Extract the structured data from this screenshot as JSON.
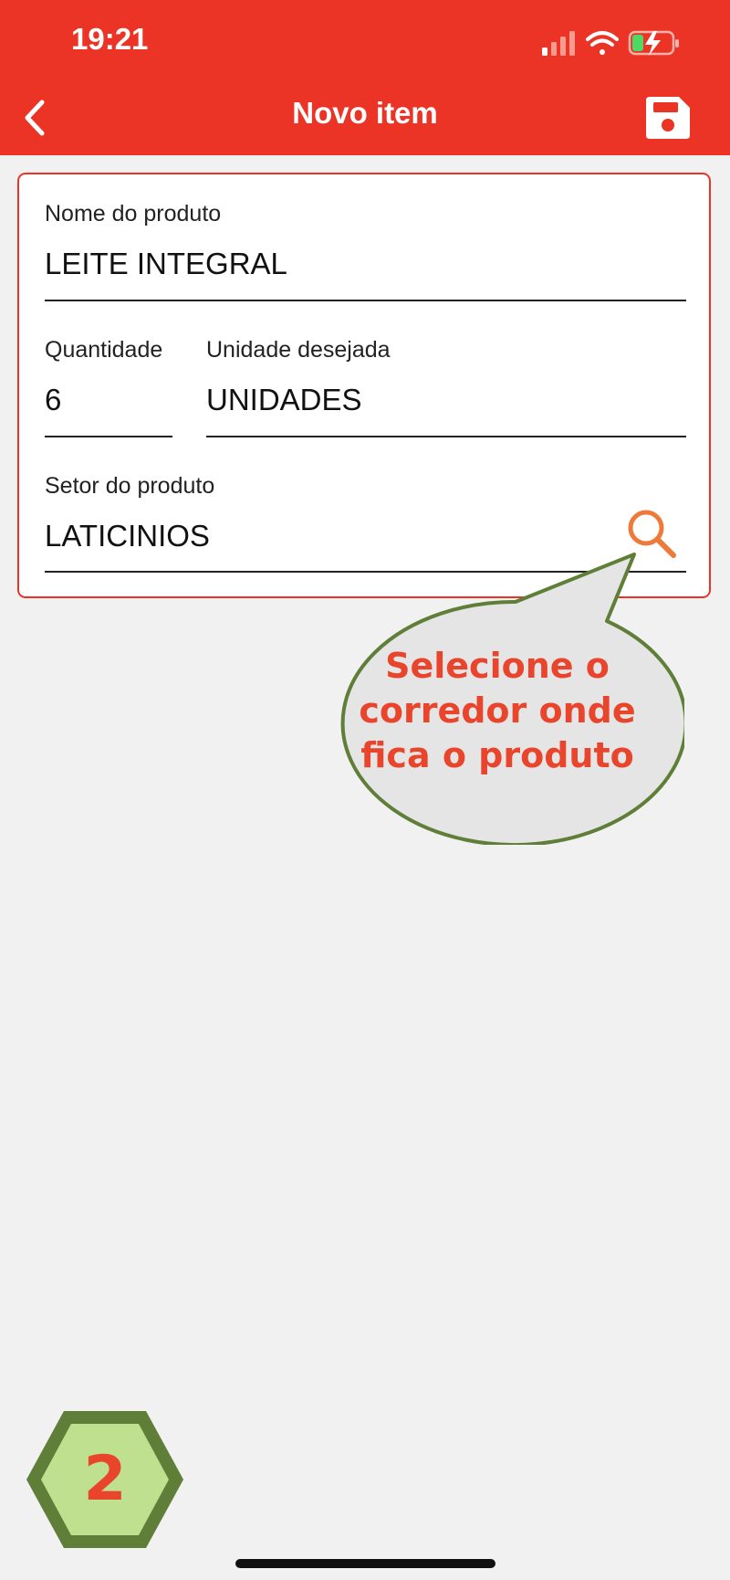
{
  "status_bar": {
    "time": "19:21"
  },
  "header": {
    "title": "Novo item"
  },
  "form": {
    "product_name": {
      "label": "Nome do produto",
      "value": "LEITE INTEGRAL"
    },
    "quantity": {
      "label": "Quantidade",
      "value": "6"
    },
    "unit": {
      "label": "Unidade desejada",
      "value": "UNIDADES"
    },
    "sector": {
      "label": "Setor do produto",
      "value": "LATICINIOS"
    }
  },
  "tooltip": {
    "line1": "Selecione o",
    "line2": "corredor onde",
    "line3": "fica o produto"
  },
  "step_badge": {
    "number": "2"
  },
  "colors": {
    "header_red": "#eb3425",
    "search_orange": "#ee7a3a",
    "tooltip_text": "#e8452c",
    "bubble_border": "#5f7e37",
    "badge_fill": "#bfe08f"
  },
  "icons": [
    "back-icon",
    "save-icon",
    "search-icon",
    "signal-icon",
    "wifi-icon",
    "battery-icon"
  ]
}
